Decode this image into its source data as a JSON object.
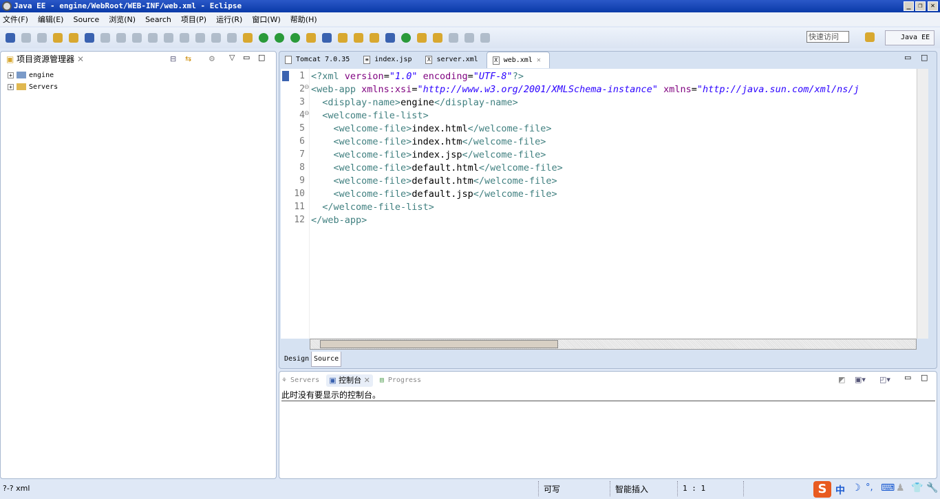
{
  "window": {
    "title": "Java EE  -  engine/WebRoot/WEB-INF/web.xml  -  Eclipse",
    "minimize": "_",
    "restore": "❐",
    "close": "✕"
  },
  "menu": [
    "文件(F)",
    "编辑(E)",
    "Source",
    "浏览(N)",
    "Search",
    "项目(P)",
    "运行(R)",
    "窗口(W)",
    "帮助(H)"
  ],
  "toolbar": {
    "quick_access_placeholder": "快速访问",
    "perspective": "Java EE"
  },
  "left_panel": {
    "title": "项目资源管理器",
    "tree": [
      {
        "label": "engine",
        "icon": "project-icon"
      },
      {
        "label": "Servers",
        "icon": "folder-icon"
      }
    ]
  },
  "editor": {
    "tabs": [
      {
        "label": "Tomcat 7.0.35",
        "icon": "server-icon"
      },
      {
        "label": "index.jsp",
        "icon": "file-icon"
      },
      {
        "label": "server.xml",
        "icon": "xml-file-icon"
      },
      {
        "label": "web.xml",
        "icon": "xml-file-icon",
        "active": true
      }
    ],
    "lines": [
      [
        [
          "t",
          "<?"
        ],
        [
          "t",
          "xml "
        ],
        [
          "a",
          "version"
        ],
        [
          "x",
          "="
        ],
        [
          "v",
          "\"1.0\""
        ],
        [
          "x",
          " "
        ],
        [
          "a",
          "encoding"
        ],
        [
          "x",
          "="
        ],
        [
          "v",
          "\"UTF-8\""
        ],
        [
          "t",
          "?>"
        ]
      ],
      [
        [
          "t",
          "<web-app "
        ],
        [
          "a",
          "xmlns:xsi"
        ],
        [
          "x",
          "="
        ],
        [
          "v",
          "\"http://www.w3.org/2001/XMLSchema-instance\""
        ],
        [
          "x",
          " "
        ],
        [
          "a",
          "xmlns"
        ],
        [
          "x",
          "="
        ],
        [
          "v",
          "\"http://java.sun.com/xml/ns/j"
        ]
      ],
      [
        [
          "x",
          "  "
        ],
        [
          "t",
          "<display-name>"
        ],
        [
          "x",
          "engine"
        ],
        [
          "t",
          "</display-name>"
        ]
      ],
      [
        [
          "x",
          "  "
        ],
        [
          "t",
          "<welcome-file-list>"
        ]
      ],
      [
        [
          "x",
          "    "
        ],
        [
          "t",
          "<welcome-file>"
        ],
        [
          "x",
          "index.html"
        ],
        [
          "t",
          "</welcome-file>"
        ]
      ],
      [
        [
          "x",
          "    "
        ],
        [
          "t",
          "<welcome-file>"
        ],
        [
          "x",
          "index.htm"
        ],
        [
          "t",
          "</welcome-file>"
        ]
      ],
      [
        [
          "x",
          "    "
        ],
        [
          "t",
          "<welcome-file>"
        ],
        [
          "x",
          "index.jsp"
        ],
        [
          "t",
          "</welcome-file>"
        ]
      ],
      [
        [
          "x",
          "    "
        ],
        [
          "t",
          "<welcome-file>"
        ],
        [
          "x",
          "default.html"
        ],
        [
          "t",
          "</welcome-file>"
        ]
      ],
      [
        [
          "x",
          "    "
        ],
        [
          "t",
          "<welcome-file>"
        ],
        [
          "x",
          "default.htm"
        ],
        [
          "t",
          "</welcome-file>"
        ]
      ],
      [
        [
          "x",
          "    "
        ],
        [
          "t",
          "<welcome-file>"
        ],
        [
          "x",
          "default.jsp"
        ],
        [
          "t",
          "</welcome-file>"
        ]
      ],
      [
        [
          "x",
          "  "
        ],
        [
          "t",
          "</welcome-file-list>"
        ]
      ],
      [
        [
          "t",
          "</web-app>"
        ]
      ]
    ],
    "bottom_tabs": [
      "Design",
      "Source"
    ]
  },
  "console": {
    "tabs": [
      {
        "label": "Servers"
      },
      {
        "label": "控制台",
        "active": true
      },
      {
        "label": "Progress"
      }
    ],
    "message": "此时没有要显示的控制台。"
  },
  "status": {
    "content_type": "?-? xml",
    "writable": "可写",
    "insert_mode": "智能插入",
    "position": "1 : 1",
    "ime": "中"
  },
  "colors": {
    "tag": "#3f7f7f",
    "attribute": "#7f007f",
    "value": "#2a00ff",
    "title_bar": "#0a3aa8"
  }
}
